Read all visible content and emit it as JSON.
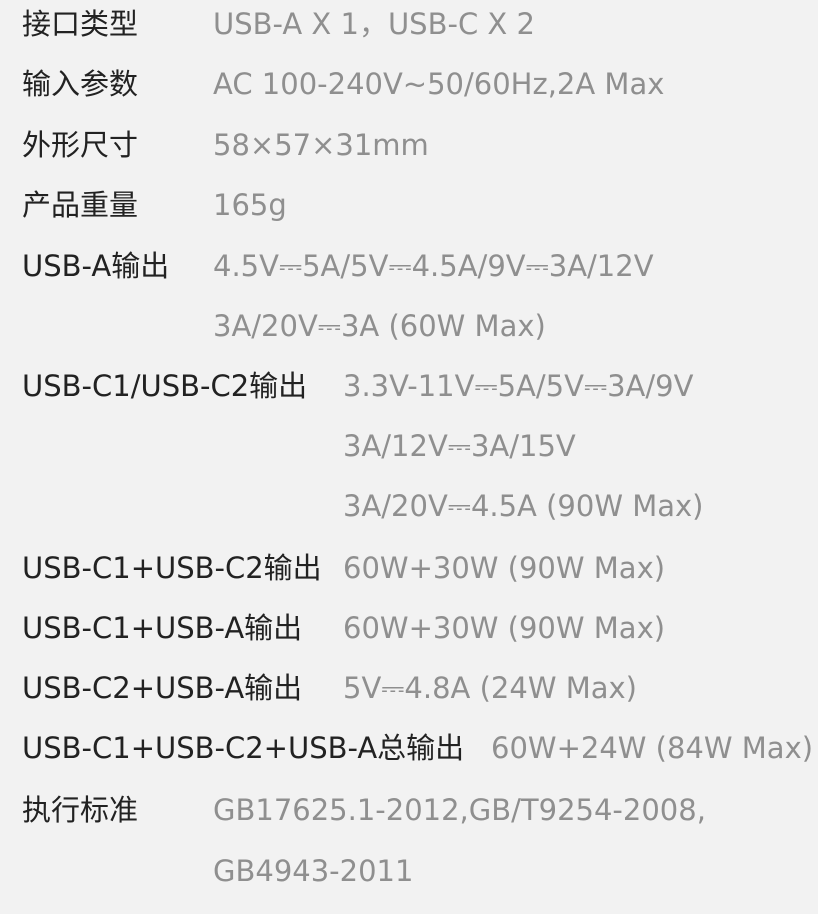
{
  "specs": [
    {
      "label": "接口类型",
      "values": [
        "USB-A X 1，USB-C X 2"
      ]
    },
    {
      "label": "输入参数",
      "values": [
        "AC 100-240V~50/60Hz,2A Max"
      ]
    },
    {
      "label": "外形尺寸",
      "values": [
        "58×57×31mm"
      ]
    },
    {
      "label": "产品重量",
      "values": [
        "165g"
      ]
    },
    {
      "label": "USB-A输出",
      "values": [
        "4.5V⎓5A/5V⎓4.5A/9V⎓3A/12V",
        "3A/20V⎓3A (60W Max)"
      ]
    },
    {
      "label": "USB-C1/USB-C2输出",
      "values": [
        "3.3V-11V⎓5A/5V⎓3A/9V",
        "3A/12V⎓3A/15V",
        "3A/20V⎓4.5A (90W Max)"
      ]
    },
    {
      "label": "USB-C1+USB-C2输出",
      "values": [
        "60W+30W (90W Max)"
      ]
    },
    {
      "label": "USB-C1+USB-A输出",
      "values": [
        "60W+30W (90W Max)"
      ]
    },
    {
      "label": "USB-C2+USB-A输出",
      "values": [
        "5V⎓4.8A (24W Max)"
      ]
    },
    {
      "label": "USB-C1+USB-C2+USB-A总输出",
      "values": [
        "60W+24W (84W Max)"
      ]
    },
    {
      "label": "执行标准",
      "values": [
        "GB17625.1-2012,GB/T9254-2008,",
        "GB4943-2011"
      ]
    }
  ]
}
